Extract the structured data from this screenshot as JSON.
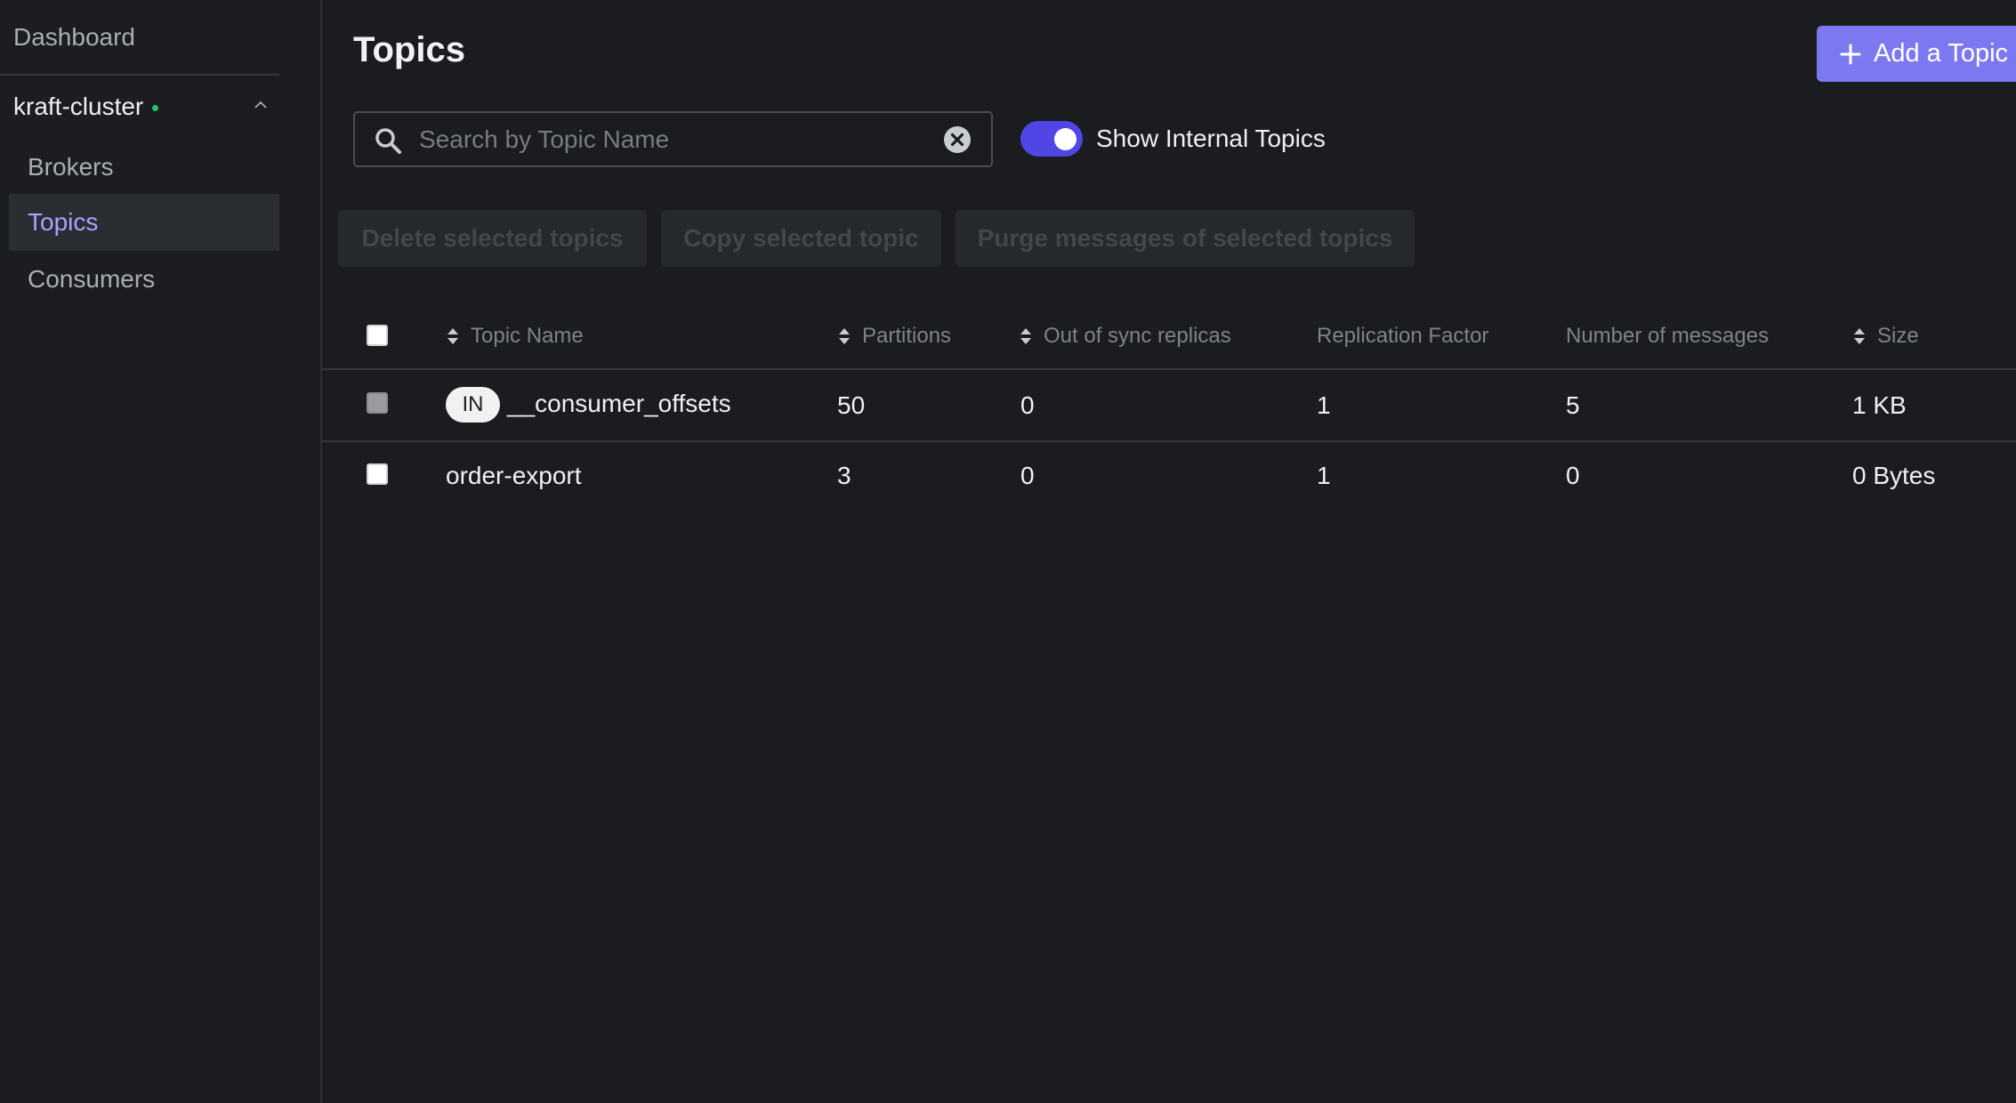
{
  "sidebar": {
    "dashboard": "Dashboard",
    "cluster_name": "kraft-cluster",
    "cluster_status_color": "#22c55e",
    "items": [
      {
        "label": "Brokers",
        "active": false
      },
      {
        "label": "Topics",
        "active": true
      },
      {
        "label": "Consumers",
        "active": false
      }
    ]
  },
  "header": {
    "title": "Topics",
    "add_button_label": "Add a Topic",
    "add_button_icon": "plus-icon",
    "accent_color": "#7c79f0"
  },
  "search": {
    "placeholder": "Search by Topic Name",
    "value": ""
  },
  "toggle": {
    "label": "Show Internal Topics",
    "on": true
  },
  "actions": {
    "delete": "Delete selected topics",
    "copy": "Copy selected topic",
    "purge": "Purge messages of selected topics"
  },
  "table": {
    "columns": {
      "topic_name": "Topic Name",
      "partitions": "Partitions",
      "out_of_sync": "Out of sync replicas",
      "replication_factor": "Replication Factor",
      "messages": "Number of messages",
      "size": "Size"
    },
    "rows": [
      {
        "badge": "IN",
        "name": "__consumer_offsets",
        "partitions": "50",
        "out_of_sync": "0",
        "replication_factor": "1",
        "messages": "5",
        "size": "1 KB"
      },
      {
        "badge": "",
        "name": "order-export",
        "partitions": "3",
        "out_of_sync": "0",
        "replication_factor": "1",
        "messages": "0",
        "size": "0 Bytes"
      }
    ]
  }
}
